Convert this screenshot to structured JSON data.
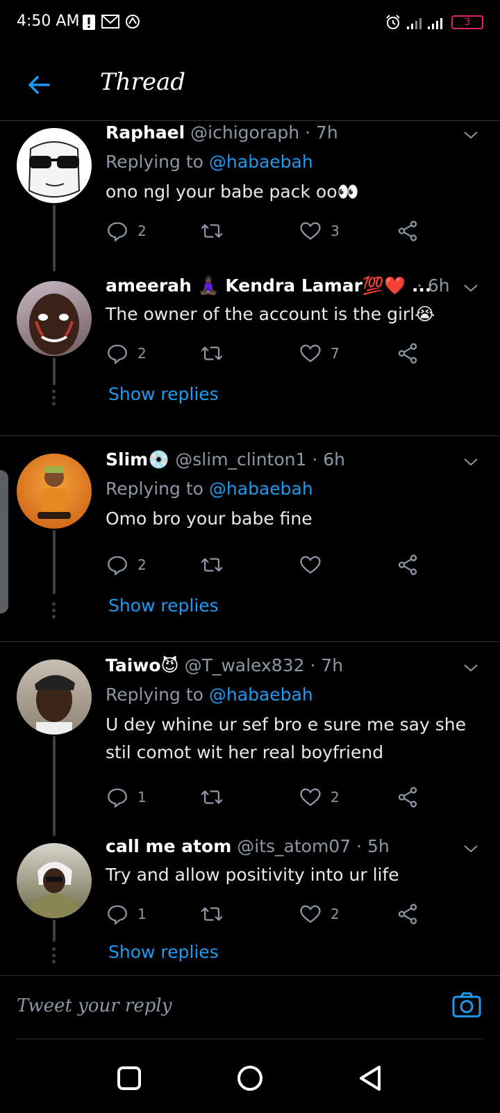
{
  "status_bar": {
    "time": "4:50 AM",
    "battery": "3"
  },
  "header": {
    "title": "Thread"
  },
  "tweets": [
    {
      "name": "Raphael",
      "handle": "@ichigoraph",
      "time": "7h",
      "replying_prefix": "Replying to",
      "replying_to": "@habaebah",
      "text": "ono ngl your babe pack oo👀",
      "replies": "2",
      "likes": "3"
    },
    {
      "name": "ameerah 🧘🏿‍♀️ Kendra Lamar💯❤️ ...",
      "time": "6h",
      "text": "The owner of the account is the girl😭",
      "replies": "2",
      "likes": "7",
      "show_replies": "Show replies"
    },
    {
      "name": "Slim💿",
      "handle": "@slim_clinton1",
      "time": "6h",
      "replying_prefix": "Replying to",
      "replying_to": "@habaebah",
      "text": "Omo bro your babe fine",
      "replies": "2",
      "likes": "",
      "show_replies": "Show replies"
    },
    {
      "name": "Taiwo😈",
      "handle": "@T_walex832",
      "time": "7h",
      "replying_prefix": "Replying to",
      "replying_to": "@habaebah",
      "text": "U dey whine ur sef bro e sure me say she stil comot wit her real boyfriend",
      "replies": "1",
      "likes": "2"
    },
    {
      "name": "call me atom",
      "handle": "@its_atom07",
      "time": "5h",
      "text": "Try and allow positivity into ur life",
      "replies": "1",
      "likes": "2",
      "show_replies": "Show replies"
    }
  ],
  "composer": {
    "placeholder": "Tweet your reply"
  },
  "colors": {
    "accent": "#1d9bf0",
    "muted": "#8b98a5",
    "background": "#000000"
  },
  "icons": [
    "back-arrow-icon",
    "chevron-down-icon",
    "reply-icon",
    "retweet-icon",
    "like-icon",
    "share-icon",
    "camera-icon",
    "square-icon",
    "circle-icon",
    "triangle-back-icon"
  ]
}
